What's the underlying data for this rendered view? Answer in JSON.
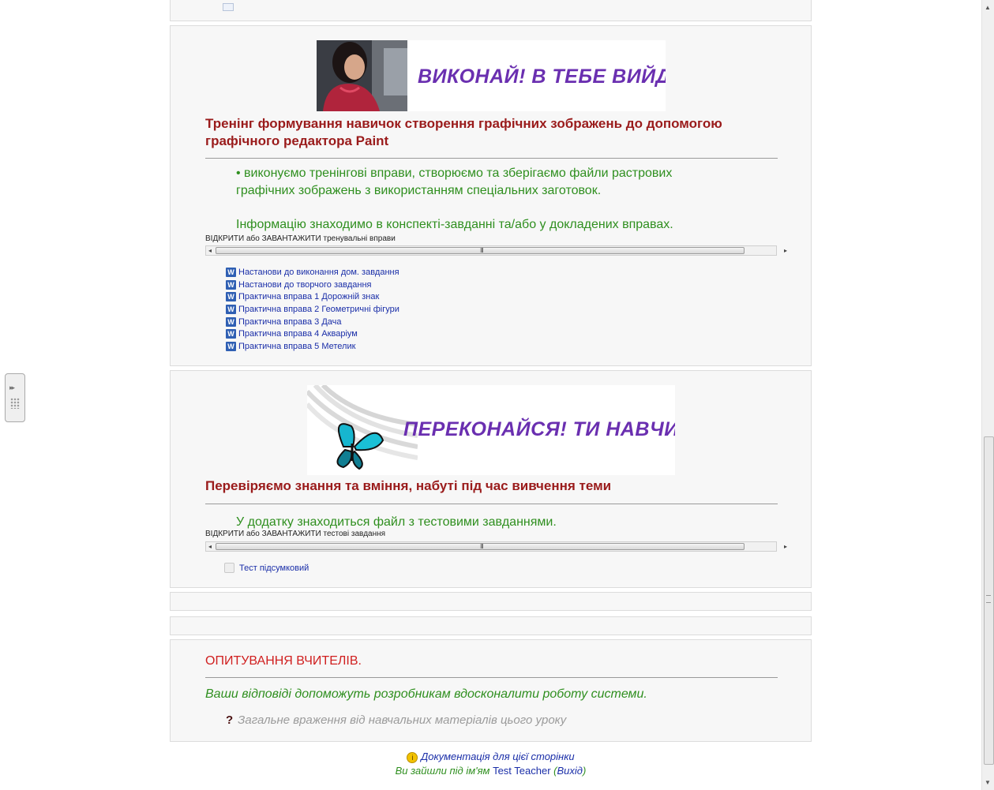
{
  "section1": {
    "banner_text": "ВИКОНАЙ! В ТЕБЕ ВИЙДЕ!",
    "heading": "Тренінг формування навичок створення графічних зображень до допомогою графічного редактора Paint",
    "bullet_line1": "• виконуємо тренінгові вправи, створюємо та зберігаємо файли растрових",
    "bullet_line2": "графічних зображень з використанням спеціальних заготовок.",
    "info": "Інформацію знаходимо в конспекті-завданні та/або у докладених вправах.",
    "open_label": "ВІДКРИТИ або ЗАВАНТАЖИТИ тренувальні вправи",
    "files": [
      "Настанови до виконання дом. завдання",
      "Настанови до творчого завдання",
      "Практична вправа 1 Дорожній знак",
      "Практична вправа 2 Геометричні фігури",
      "Практична вправа 3 Дача",
      "Практична вправа 4 Акваріум",
      "Практична вправа 5 Метелик"
    ]
  },
  "section2": {
    "banner_text": "ПЕРЕКОНАЙСЯ! ТИ НАВЧИВСЯ!",
    "heading": "Перевіряємо знання та вміння, набуті під час вивчення теми",
    "info": "У додатку знаходиться файл з тестовими завданнями.",
    "open_label": "ВІДКРИТИ або ЗАВАНТАЖИТИ тестові завдання",
    "test_link": "Тест підсумковий"
  },
  "section3": {
    "heading": "ОПИТУВАННЯ ВЧИТЕЛІВ.",
    "subtitle": "Ваши відповіді допоможуть розробникам вдосконалити роботу системи.",
    "question_icon": "?",
    "question": "Загальне враження від навчальних матеріалів цього уроку"
  },
  "footer": {
    "doc_link": "Документація для цієї сторінки",
    "logged_prefix": "Ви зайшли під ім'ям",
    "user": "Test Teacher",
    "logout": "Вихід"
  },
  "icons": {
    "word_doc": "word-document-icon",
    "quiz": "quiz-icon",
    "info": "info-icon",
    "question": "question-icon"
  },
  "colors": {
    "heading_red": "#9a1b1b",
    "text_green": "#2f8f1f",
    "link_blue": "#1a2ea8",
    "banner_purple": "#6a2fb0",
    "survey_red": "#d02020"
  }
}
